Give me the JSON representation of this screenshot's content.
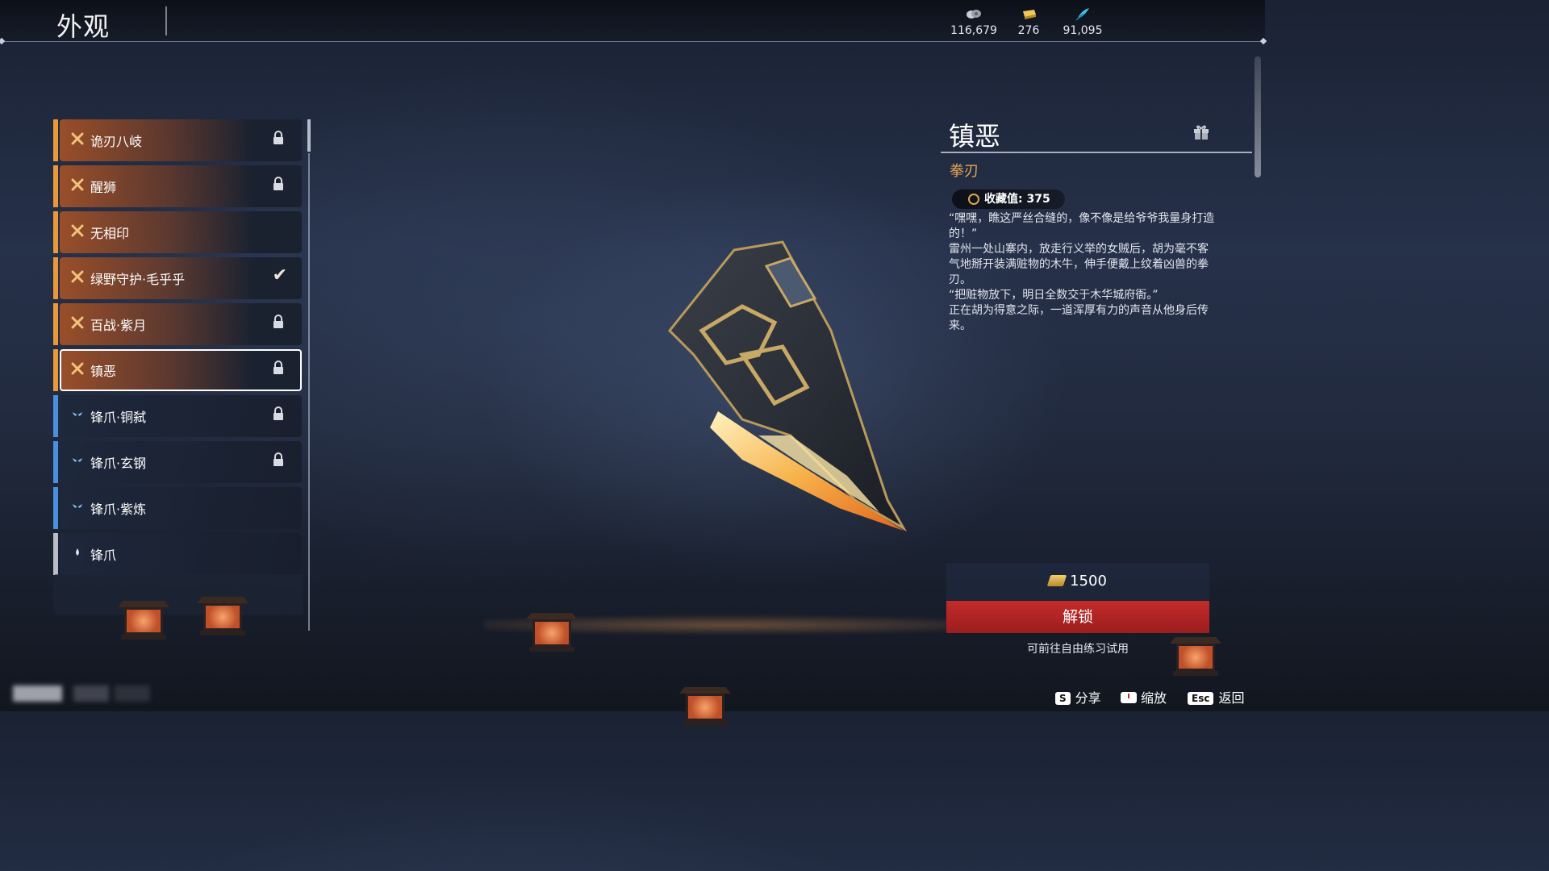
{
  "header": {
    "title": "外观",
    "currencies": [
      {
        "icon": "coin-pouch-icon",
        "value": "116,679"
      },
      {
        "icon": "gold-ingot-icon",
        "value": "276"
      },
      {
        "icon": "feather-icon",
        "value": "91,095"
      }
    ]
  },
  "skins": [
    {
      "name": "诡刃八岐",
      "rarity": "legendary",
      "state": "locked"
    },
    {
      "name": "醒狮",
      "rarity": "legendary",
      "state": "locked"
    },
    {
      "name": "无相印",
      "rarity": "legendary",
      "state": "owned"
    },
    {
      "name": "绿野守护·毛乎乎",
      "rarity": "legendary",
      "state": "equipped"
    },
    {
      "name": "百战·紫月",
      "rarity": "legendary",
      "state": "locked"
    },
    {
      "name": "镇恶",
      "rarity": "legendary",
      "state": "locked",
      "selected": true
    },
    {
      "name": "锋爪·铜弑",
      "rarity": "rare",
      "state": "locked"
    },
    {
      "name": "锋爪·玄钢",
      "rarity": "rare",
      "state": "locked"
    },
    {
      "name": "锋爪·紫炼",
      "rarity": "rare",
      "state": "owned"
    },
    {
      "name": "锋爪",
      "rarity": "common",
      "state": "owned"
    }
  ],
  "detail": {
    "name": "镇恶",
    "type": "拳刃",
    "collection_label": "收藏值: 375",
    "description": [
      "“嘿嘿，瞧这严丝合缝的，像不像是给爷爷我量身打造的！”",
      "雷州一处山寨内，放走行义举的女贼后，胡为毫不客气地掰开装满赃物的木牛，伸手便戴上纹着凶兽的拳刃。",
      "“把赃物放下，明日全数交于木华城府衙。”",
      "正在胡为得意之际，一道浑厚有力的声音从他身后传来。"
    ]
  },
  "purchase": {
    "price": "1500",
    "unlock_label": "解锁",
    "trial_text": "可前往自由练习试用"
  },
  "footer": {
    "share": {
      "key": "S",
      "label": "分享"
    },
    "zoom": {
      "label": "缩放"
    },
    "back": {
      "key": "Esc",
      "label": "返回"
    }
  },
  "colors": {
    "legendary": "#e89a3a",
    "rare": "#4a8fe0",
    "common": "#b8bcc6",
    "accent_orange": "#e6a553",
    "unlock_red": "#b62424"
  }
}
